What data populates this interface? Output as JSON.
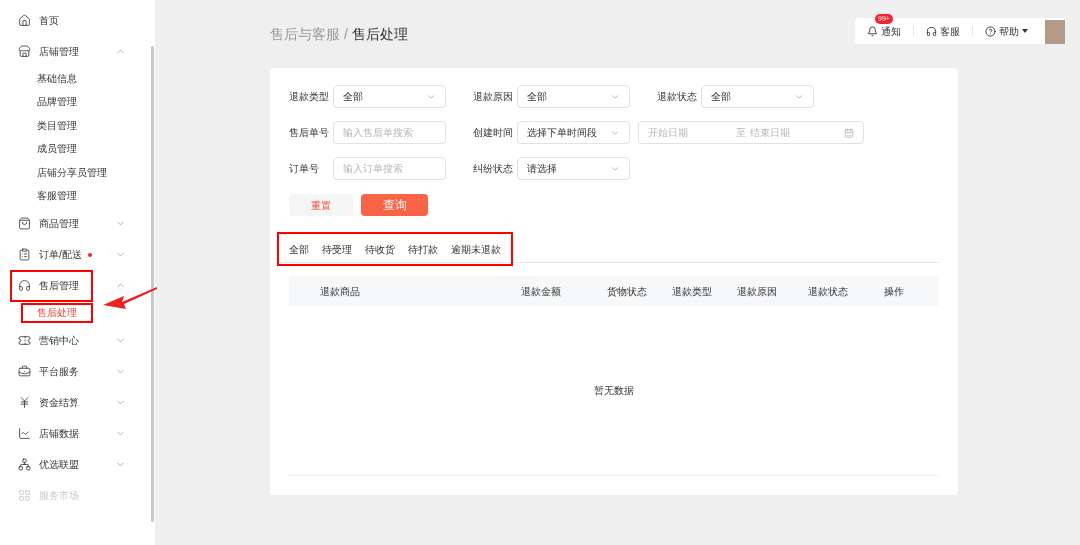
{
  "sidebar": {
    "items": [
      {
        "label": "首页",
        "kind": "link"
      },
      {
        "label": "店铺管理",
        "kind": "group",
        "expanded": true,
        "children": [
          {
            "label": "基础信息",
            "selected": false
          },
          {
            "label": "品牌管理",
            "selected": false
          },
          {
            "label": "类目管理",
            "selected": false
          },
          {
            "label": "成员管理",
            "selected": false
          },
          {
            "label": "店铺分享员管理",
            "selected": false
          },
          {
            "label": "客服管理",
            "selected": false
          }
        ]
      },
      {
        "label": "商品管理",
        "kind": "group",
        "expanded": false
      },
      {
        "label": "订单/配送",
        "kind": "group",
        "expanded": false,
        "dot": true
      },
      {
        "label": "售后管理",
        "kind": "group",
        "expanded": true,
        "annotated": true,
        "children": [
          {
            "label": "售后处理",
            "selected": true,
            "annotated": true
          }
        ]
      },
      {
        "label": "营销中心",
        "kind": "group",
        "expanded": false
      },
      {
        "label": "平台服务",
        "kind": "group",
        "expanded": false
      },
      {
        "label": "资金结算",
        "kind": "group",
        "expanded": false
      },
      {
        "label": "店铺数据",
        "kind": "group",
        "expanded": false
      },
      {
        "label": "优选联盟",
        "kind": "group",
        "expanded": false
      },
      {
        "label": "服务市场",
        "kind": "link",
        "disabled": true
      }
    ]
  },
  "header": {
    "notice": {
      "label": "通知",
      "badge": "99+"
    },
    "service": {
      "label": "客服"
    },
    "help": {
      "label": "帮助"
    }
  },
  "breadcrumb": {
    "parent": "售后与客服 /",
    "current": "售后处理"
  },
  "filters": [
    [
      {
        "label": "退款类型",
        "kind": "select",
        "value": "全部"
      },
      {
        "label": "退款原因",
        "kind": "select",
        "value": "全部"
      },
      {
        "label": "退款状态",
        "kind": "select",
        "value": "全部"
      }
    ],
    [
      {
        "label": "售后单号",
        "kind": "input",
        "placeholder": "输入售后单搜索"
      },
      {
        "label": "创建时间",
        "kind": "select",
        "value": "选择下单时间段"
      },
      {
        "kind": "daterange",
        "start_placeholder": "开始日期",
        "separator": "至",
        "end_placeholder": "结束日期"
      }
    ],
    [
      {
        "label": "订单号",
        "kind": "input",
        "placeholder": "输入订单搜索"
      },
      {
        "label": "纠纷状态",
        "kind": "select",
        "value": "请选择"
      }
    ]
  ],
  "buttons": {
    "reset": "重置",
    "query": "查询"
  },
  "tabs": {
    "annotated": true,
    "items": [
      {
        "label": "全部",
        "selected": false
      },
      {
        "label": "待受理",
        "selected": false
      },
      {
        "label": "待收货",
        "selected": false
      },
      {
        "label": "待打款",
        "selected": false
      },
      {
        "label": "逾期未退款",
        "selected": false
      }
    ]
  },
  "table": {
    "columns": [
      "退款商品",
      "退款金额",
      "货物状态",
      "退款类型",
      "退款原因",
      "退款状态",
      "操作"
    ],
    "empty_text": "暂无数据"
  },
  "annotation_arrow": true
}
